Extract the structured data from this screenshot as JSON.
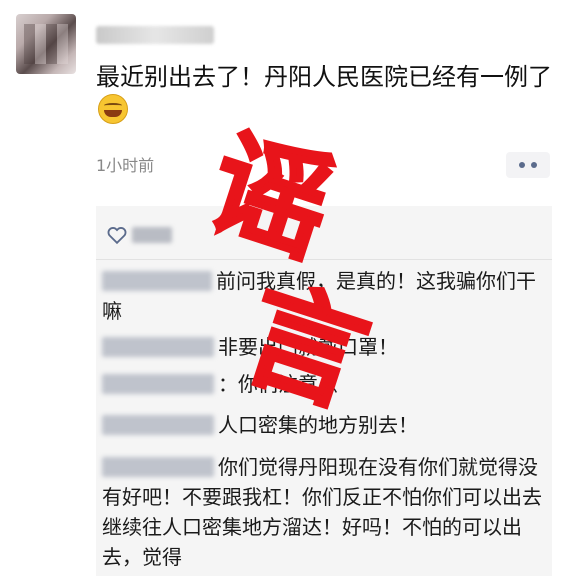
{
  "post": {
    "text": "最近别出去了！丹阳人民医院已经有一例了",
    "timestamp": "1小时前"
  },
  "comments": [
    {
      "text": "前问我真假，是真的！这我骗你们干嘛"
    },
    {
      "text": "非要出门就戴口罩！"
    },
    {
      "text": "：你们注意点"
    },
    {
      "text": "人口密集的地方别去！"
    },
    {
      "text": "你们觉得丹阳现在没有你们就觉得没有好吧！不要跟我杠！你们反正不怕你们可以出去继续往人口密集地方溜达！好吗！不怕的可以出去，觉得"
    }
  ],
  "stamp": {
    "text": "谣言",
    "color": "#e8141a"
  },
  "icons": {
    "like": "heart-outline-icon",
    "more": "more-dots-icon",
    "reaction": "laughing-tears-emoji-icon"
  }
}
